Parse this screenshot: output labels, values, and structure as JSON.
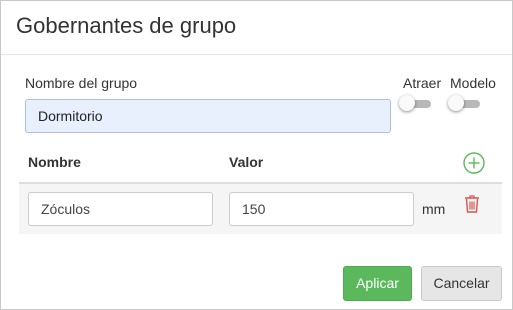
{
  "dialog": {
    "title": "Gobernantes de grupo",
    "group_name_label": "Nombre del grupo",
    "group_name_value": "Dormitorio",
    "toggles": [
      {
        "label": "Atraer",
        "on": false
      },
      {
        "label": "Modelo",
        "on": false
      }
    ],
    "table": {
      "headers": {
        "name": "Nombre",
        "value": "Valor"
      },
      "rows": [
        {
          "name": "Zóculos",
          "value": "150",
          "unit": "mm"
        }
      ]
    },
    "buttons": {
      "apply": "Aplicar",
      "cancel": "Cancelar"
    },
    "colors": {
      "apply": "#5cb85c",
      "add_icon": "#5cb85c",
      "delete_icon": "#d9534f"
    },
    "icons": {
      "add": "plus-circle-icon",
      "delete": "trash-icon"
    }
  }
}
